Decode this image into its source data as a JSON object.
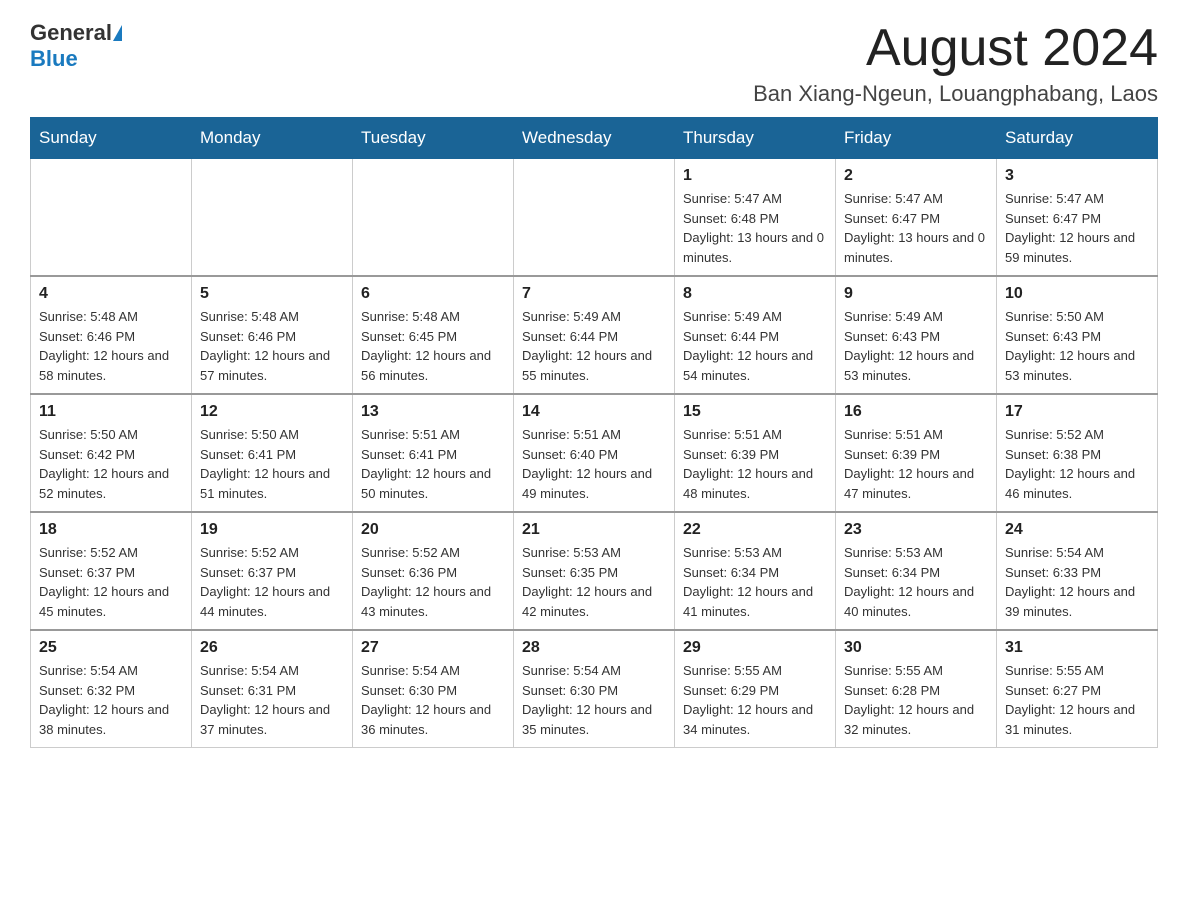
{
  "header": {
    "logo_general": "General",
    "logo_blue": "Blue",
    "title": "August 2024",
    "location": "Ban Xiang-Ngeun, Louangphabang, Laos"
  },
  "days_of_week": [
    "Sunday",
    "Monday",
    "Tuesday",
    "Wednesday",
    "Thursday",
    "Friday",
    "Saturday"
  ],
  "weeks": [
    [
      {
        "day": "",
        "sunrise": "",
        "sunset": "",
        "daylight": ""
      },
      {
        "day": "",
        "sunrise": "",
        "sunset": "",
        "daylight": ""
      },
      {
        "day": "",
        "sunrise": "",
        "sunset": "",
        "daylight": ""
      },
      {
        "day": "",
        "sunrise": "",
        "sunset": "",
        "daylight": ""
      },
      {
        "day": "1",
        "sunrise": "Sunrise: 5:47 AM",
        "sunset": "Sunset: 6:48 PM",
        "daylight": "Daylight: 13 hours and 0 minutes."
      },
      {
        "day": "2",
        "sunrise": "Sunrise: 5:47 AM",
        "sunset": "Sunset: 6:47 PM",
        "daylight": "Daylight: 13 hours and 0 minutes."
      },
      {
        "day": "3",
        "sunrise": "Sunrise: 5:47 AM",
        "sunset": "Sunset: 6:47 PM",
        "daylight": "Daylight: 12 hours and 59 minutes."
      }
    ],
    [
      {
        "day": "4",
        "sunrise": "Sunrise: 5:48 AM",
        "sunset": "Sunset: 6:46 PM",
        "daylight": "Daylight: 12 hours and 58 minutes."
      },
      {
        "day": "5",
        "sunrise": "Sunrise: 5:48 AM",
        "sunset": "Sunset: 6:46 PM",
        "daylight": "Daylight: 12 hours and 57 minutes."
      },
      {
        "day": "6",
        "sunrise": "Sunrise: 5:48 AM",
        "sunset": "Sunset: 6:45 PM",
        "daylight": "Daylight: 12 hours and 56 minutes."
      },
      {
        "day": "7",
        "sunrise": "Sunrise: 5:49 AM",
        "sunset": "Sunset: 6:44 PM",
        "daylight": "Daylight: 12 hours and 55 minutes."
      },
      {
        "day": "8",
        "sunrise": "Sunrise: 5:49 AM",
        "sunset": "Sunset: 6:44 PM",
        "daylight": "Daylight: 12 hours and 54 minutes."
      },
      {
        "day": "9",
        "sunrise": "Sunrise: 5:49 AM",
        "sunset": "Sunset: 6:43 PM",
        "daylight": "Daylight: 12 hours and 53 minutes."
      },
      {
        "day": "10",
        "sunrise": "Sunrise: 5:50 AM",
        "sunset": "Sunset: 6:43 PM",
        "daylight": "Daylight: 12 hours and 53 minutes."
      }
    ],
    [
      {
        "day": "11",
        "sunrise": "Sunrise: 5:50 AM",
        "sunset": "Sunset: 6:42 PM",
        "daylight": "Daylight: 12 hours and 52 minutes."
      },
      {
        "day": "12",
        "sunrise": "Sunrise: 5:50 AM",
        "sunset": "Sunset: 6:41 PM",
        "daylight": "Daylight: 12 hours and 51 minutes."
      },
      {
        "day": "13",
        "sunrise": "Sunrise: 5:51 AM",
        "sunset": "Sunset: 6:41 PM",
        "daylight": "Daylight: 12 hours and 50 minutes."
      },
      {
        "day": "14",
        "sunrise": "Sunrise: 5:51 AM",
        "sunset": "Sunset: 6:40 PM",
        "daylight": "Daylight: 12 hours and 49 minutes."
      },
      {
        "day": "15",
        "sunrise": "Sunrise: 5:51 AM",
        "sunset": "Sunset: 6:39 PM",
        "daylight": "Daylight: 12 hours and 48 minutes."
      },
      {
        "day": "16",
        "sunrise": "Sunrise: 5:51 AM",
        "sunset": "Sunset: 6:39 PM",
        "daylight": "Daylight: 12 hours and 47 minutes."
      },
      {
        "day": "17",
        "sunrise": "Sunrise: 5:52 AM",
        "sunset": "Sunset: 6:38 PM",
        "daylight": "Daylight: 12 hours and 46 minutes."
      }
    ],
    [
      {
        "day": "18",
        "sunrise": "Sunrise: 5:52 AM",
        "sunset": "Sunset: 6:37 PM",
        "daylight": "Daylight: 12 hours and 45 minutes."
      },
      {
        "day": "19",
        "sunrise": "Sunrise: 5:52 AM",
        "sunset": "Sunset: 6:37 PM",
        "daylight": "Daylight: 12 hours and 44 minutes."
      },
      {
        "day": "20",
        "sunrise": "Sunrise: 5:52 AM",
        "sunset": "Sunset: 6:36 PM",
        "daylight": "Daylight: 12 hours and 43 minutes."
      },
      {
        "day": "21",
        "sunrise": "Sunrise: 5:53 AM",
        "sunset": "Sunset: 6:35 PM",
        "daylight": "Daylight: 12 hours and 42 minutes."
      },
      {
        "day": "22",
        "sunrise": "Sunrise: 5:53 AM",
        "sunset": "Sunset: 6:34 PM",
        "daylight": "Daylight: 12 hours and 41 minutes."
      },
      {
        "day": "23",
        "sunrise": "Sunrise: 5:53 AM",
        "sunset": "Sunset: 6:34 PM",
        "daylight": "Daylight: 12 hours and 40 minutes."
      },
      {
        "day": "24",
        "sunrise": "Sunrise: 5:54 AM",
        "sunset": "Sunset: 6:33 PM",
        "daylight": "Daylight: 12 hours and 39 minutes."
      }
    ],
    [
      {
        "day": "25",
        "sunrise": "Sunrise: 5:54 AM",
        "sunset": "Sunset: 6:32 PM",
        "daylight": "Daylight: 12 hours and 38 minutes."
      },
      {
        "day": "26",
        "sunrise": "Sunrise: 5:54 AM",
        "sunset": "Sunset: 6:31 PM",
        "daylight": "Daylight: 12 hours and 37 minutes."
      },
      {
        "day": "27",
        "sunrise": "Sunrise: 5:54 AM",
        "sunset": "Sunset: 6:30 PM",
        "daylight": "Daylight: 12 hours and 36 minutes."
      },
      {
        "day": "28",
        "sunrise": "Sunrise: 5:54 AM",
        "sunset": "Sunset: 6:30 PM",
        "daylight": "Daylight: 12 hours and 35 minutes."
      },
      {
        "day": "29",
        "sunrise": "Sunrise: 5:55 AM",
        "sunset": "Sunset: 6:29 PM",
        "daylight": "Daylight: 12 hours and 34 minutes."
      },
      {
        "day": "30",
        "sunrise": "Sunrise: 5:55 AM",
        "sunset": "Sunset: 6:28 PM",
        "daylight": "Daylight: 12 hours and 32 minutes."
      },
      {
        "day": "31",
        "sunrise": "Sunrise: 5:55 AM",
        "sunset": "Sunset: 6:27 PM",
        "daylight": "Daylight: 12 hours and 31 minutes."
      }
    ]
  ]
}
